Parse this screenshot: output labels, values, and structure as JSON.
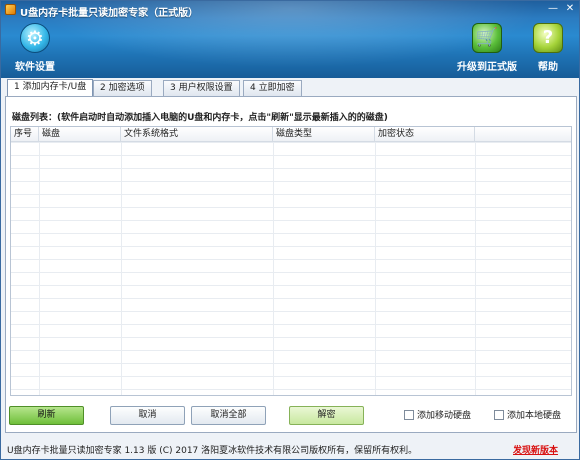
{
  "window": {
    "title": "U盘内存卡批量只读加密专家（正式版）",
    "minimize_symbol": "—",
    "close_symbol": "✕"
  },
  "toolbar": {
    "settings": {
      "label": "软件设置",
      "icon": "gear-icon",
      "glyph": "⚙"
    },
    "upgrade": {
      "label": "升级到正式版",
      "icon": "cart-icon",
      "glyph": "🛒"
    },
    "help": {
      "label": "帮助",
      "icon": "help-icon",
      "glyph": "?"
    }
  },
  "tabs": [
    {
      "label": "1 添加内存卡/U盘",
      "active": true
    },
    {
      "label": "2 加密选项",
      "active": false
    },
    {
      "label": "3 用户权限设置",
      "active": false
    },
    {
      "label": "4 立即加密",
      "active": false
    }
  ],
  "disk_list": {
    "label": "磁盘列表：(软件启动时自动添加插入电脑的U盘和内存卡，点击\"刷新\"显示最新插入的的磁盘)",
    "columns": [
      "序号",
      "磁盘",
      "文件系统格式",
      "磁盘类型",
      "加密状态"
    ],
    "rows": []
  },
  "buttons": {
    "refresh": "刷新",
    "cancel": "取消",
    "cancel_all": "取消全部",
    "decrypt": "解密"
  },
  "checkboxes": {
    "add_removable": {
      "label": "添加移动硬盘",
      "checked": false
    },
    "add_local": {
      "label": "添加本地硬盘",
      "checked": false
    }
  },
  "status": {
    "text": "U盘内存卡批量只读加密专家 1.13 版  (C) 2017 洛阳夏冰软件技术有限公司版权所有，保留所有权利。",
    "link": "发现新版本"
  },
  "colors": {
    "header_blue": "#2b7bc0",
    "link_red": "#d81010",
    "button_green": "#6fbf3a"
  }
}
